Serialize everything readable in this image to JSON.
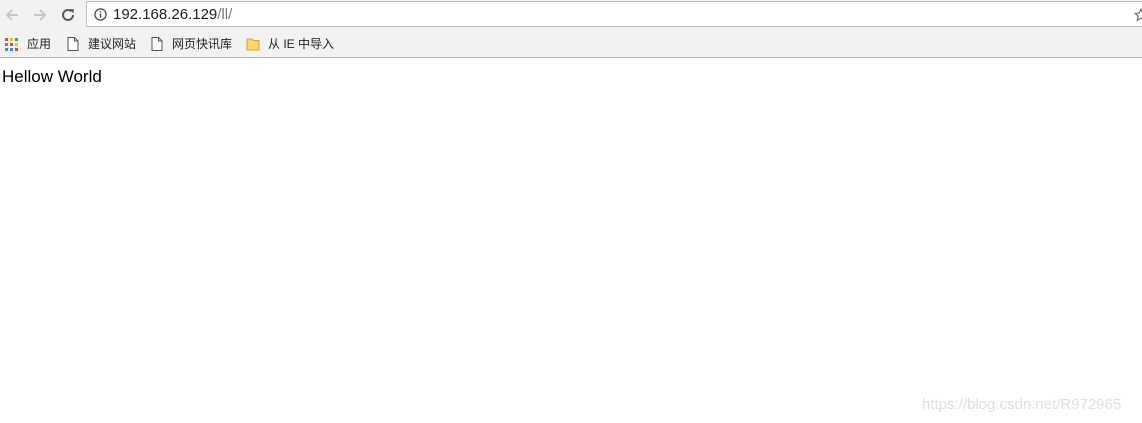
{
  "toolbar": {
    "back_icon": "arrow-left-icon",
    "forward_icon": "arrow-right-icon",
    "reload_icon": "reload-icon",
    "address": {
      "host": "192.168.26.129",
      "path": "/ll/",
      "info_icon": "info-icon",
      "bookmark_icon": "star-icon"
    }
  },
  "bookmarks": {
    "items": [
      {
        "label": "应用",
        "icon": "apps-grid-icon"
      },
      {
        "label": "建议网站",
        "icon": "page-icon"
      },
      {
        "label": "网页快讯库",
        "icon": "page-icon"
      },
      {
        "label": "从 IE 中导入",
        "icon": "folder-icon"
      }
    ]
  },
  "page": {
    "text": "Hellow World"
  },
  "watermark": "https://blog.csdn.net/R972965",
  "colors": {
    "chrome_bg": "#f2f2f2",
    "apps_red": "#e8453c",
    "apps_yellow": "#f9bb2d",
    "apps_green": "#3aa757",
    "apps_blue": "#4285f4",
    "folder": "#f7d66a"
  }
}
